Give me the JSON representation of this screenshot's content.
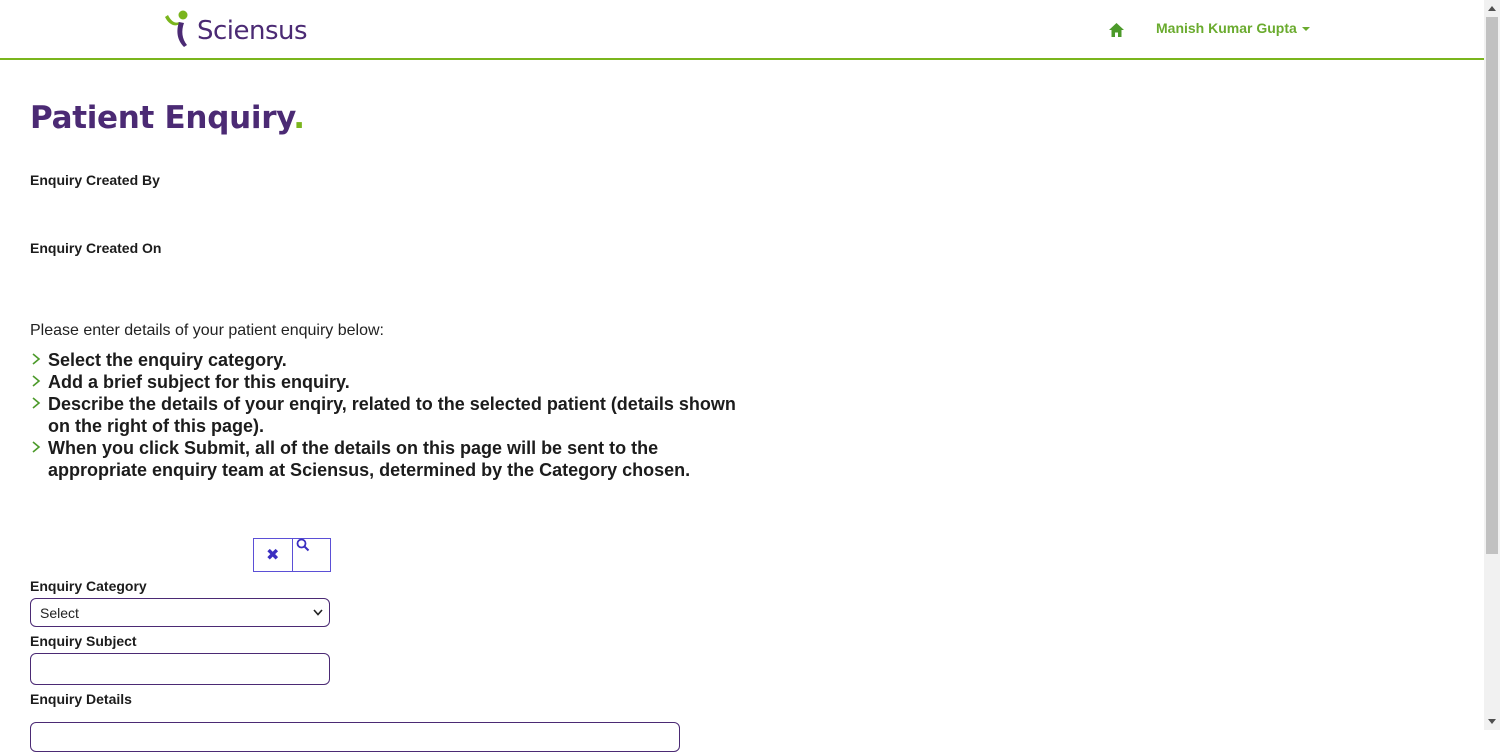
{
  "header": {
    "logo_text": "Sciensus",
    "home_icon": "home-icon",
    "user_name": "Manish Kumar Gupta"
  },
  "page": {
    "title": "Patient Enquiry",
    "title_dot": "."
  },
  "info": {
    "created_by_label": "Enquiry Created By",
    "created_on_label": "Enquiry Created On"
  },
  "intro": "Please enter details of your patient enquiry below:",
  "instructions": [
    "Select the enquiry category.",
    "Add a brief subject for this enquiry.",
    "Describe the details of your enqiry, related to the selected patient (details shown on the right of this page).",
    "When you click Submit, all of the details on this page will be sent to the appropriate enquiry team at Sciensus, determined by the Category chosen."
  ],
  "search": {
    "clear_icon": "✖",
    "search_icon": "search-icon"
  },
  "form": {
    "category_label": "Enquiry Category",
    "category_value": "Select",
    "subject_label": "Enquiry Subject",
    "subject_value": "",
    "details_label": "Enquiry Details",
    "details_value": ""
  },
  "colors": {
    "brand_purple": "#4b2a74",
    "brand_green": "#7ab51d",
    "link_green": "#6aab2e",
    "search_border": "#5b4fd6"
  }
}
